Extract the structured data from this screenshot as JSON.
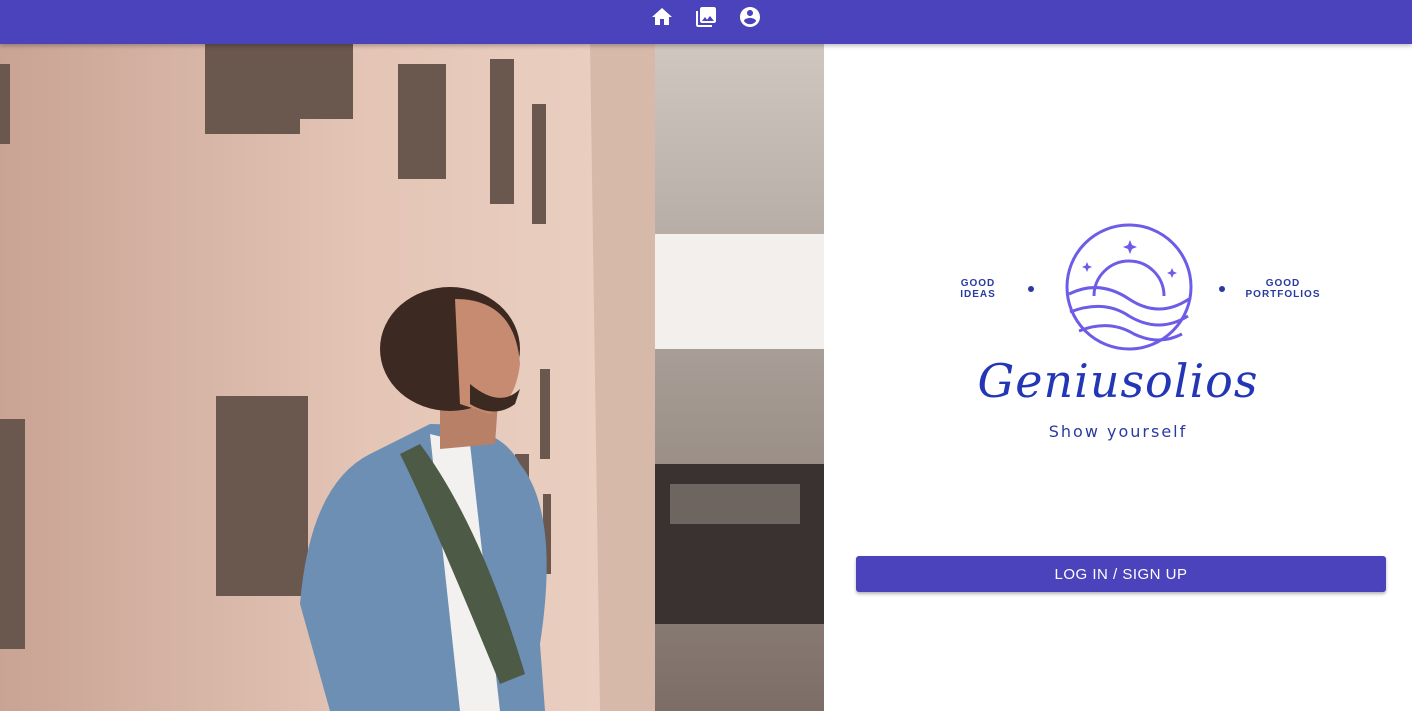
{
  "colors": {
    "accent": "#4a43bb",
    "brand_blue": "#2a3aa0",
    "logo_purple": "#6c5ce7"
  },
  "nav": {
    "icons": [
      "home-icon",
      "photo-library-icon",
      "account-circle-icon"
    ]
  },
  "hero_image": {
    "alt": "Man in denim jacket looking up beside a wall"
  },
  "logo": {
    "left_label_line1": "GOOD",
    "left_label_line2": "IDEAS",
    "right_label_line1": "GOOD",
    "right_label_line2": "PORTFOLIOS",
    "wordmark": "Geniusolios",
    "tagline": "Show yourself"
  },
  "auth": {
    "button_label": "LOG IN / SIGN UP"
  }
}
